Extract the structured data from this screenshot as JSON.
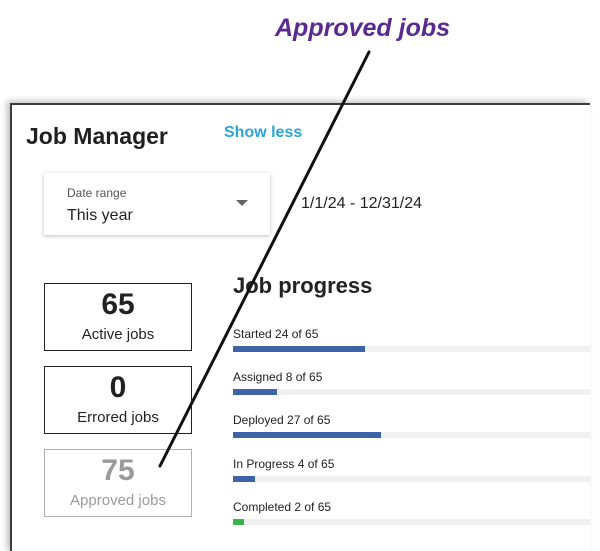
{
  "callout": {
    "text": "Approved jobs"
  },
  "header": {
    "title": "Job Manager",
    "show_less": "Show less"
  },
  "date_filter": {
    "label": "Date range",
    "value": "This year",
    "range_text": "1/1/24 - 12/31/24"
  },
  "stats": [
    {
      "value": "65",
      "label": "Active jobs"
    },
    {
      "value": "0",
      "label": "Errored jobs"
    },
    {
      "value": "75",
      "label": "Approved jobs"
    }
  ],
  "progress": {
    "title": "Job progress",
    "total": 65,
    "items": [
      {
        "label": "Started 24 of 65",
        "count": 24,
        "color": "#3f63a8"
      },
      {
        "label": "Assigned 8 of 65",
        "count": 8,
        "color": "#3f63a8"
      },
      {
        "label": "Deployed 27 of 65",
        "count": 27,
        "color": "#3f63a8"
      },
      {
        "label": "In Progress 4 of 65",
        "count": 4,
        "color": "#3f63a8"
      },
      {
        "label": "Completed 2 of 65",
        "count": 2,
        "color": "#3ab44a"
      }
    ]
  },
  "colors": {
    "accent_link": "#2aa4d9",
    "callout": "#5b2a91",
    "bar_default": "#3f63a8",
    "bar_complete": "#3ab44a"
  }
}
